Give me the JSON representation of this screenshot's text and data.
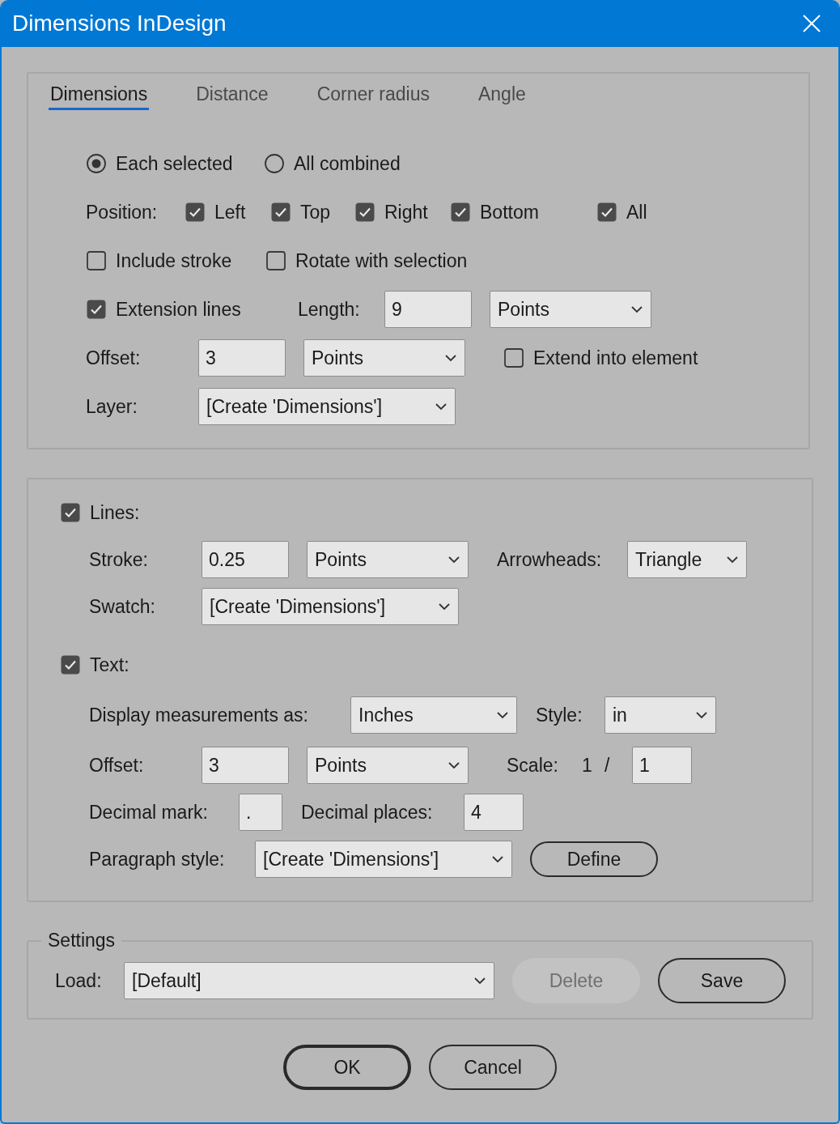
{
  "window": {
    "title": "Dimensions InDesign"
  },
  "tabs": [
    {
      "label": "Dimensions",
      "selected": true
    },
    {
      "label": "Distance",
      "selected": false
    },
    {
      "label": "Corner radius",
      "selected": false
    },
    {
      "label": "Angle",
      "selected": false
    }
  ],
  "mode": [
    {
      "label": "Each selected",
      "selected": true
    },
    {
      "label": "All combined",
      "selected": false
    }
  ],
  "position": {
    "label": "Position:",
    "options": [
      {
        "label": "Left",
        "checked": true
      },
      {
        "label": "Top",
        "checked": true
      },
      {
        "label": "Right",
        "checked": true
      },
      {
        "label": "Bottom",
        "checked": true
      },
      {
        "label": "All",
        "checked": true
      }
    ]
  },
  "include_stroke": {
    "label": "Include stroke",
    "checked": false
  },
  "rotate_with_selection": {
    "label": "Rotate with selection",
    "checked": false
  },
  "extension_lines": {
    "label": "Extension lines",
    "checked": true
  },
  "length": {
    "label": "Length:",
    "value": "9",
    "unit": "Points"
  },
  "offset": {
    "label": "Offset:",
    "value": "3",
    "unit": "Points"
  },
  "extend_into_element": {
    "label": "Extend into element",
    "checked": false
  },
  "layer": {
    "label": "Layer:",
    "value": "[Create 'Dimensions']"
  },
  "lines": {
    "label": "Lines:",
    "checked": true,
    "stroke": {
      "label": "Stroke:",
      "value": "0.25",
      "unit": "Points"
    },
    "arrowheads": {
      "label": "Arrowheads:",
      "value": "Triangle"
    },
    "swatch": {
      "label": "Swatch:",
      "value": "[Create 'Dimensions']"
    }
  },
  "text": {
    "label": "Text:",
    "checked": true,
    "display": {
      "label": "Display measurements as:",
      "value": "Inches"
    },
    "style": {
      "label": "Style:",
      "value": "in"
    },
    "offset": {
      "label": "Offset:",
      "value": "3",
      "unit": "Points"
    },
    "scale": {
      "label": "Scale:",
      "numerator": "1",
      "separator": "/",
      "value": "1"
    },
    "decimal_mark": {
      "label": "Decimal mark:",
      "value": "."
    },
    "decimal_places": {
      "label": "Decimal places:",
      "value": "4"
    },
    "paragraph_style": {
      "label": "Paragraph style:",
      "value": "[Create 'Dimensions']",
      "button": "Define"
    }
  },
  "settings": {
    "legend": "Settings",
    "load": {
      "label": "Load:",
      "value": "[Default]"
    },
    "buttons": [
      {
        "label": "Delete",
        "disabled": true
      },
      {
        "label": "Save",
        "disabled": false
      }
    ]
  },
  "footer_buttons": [
    {
      "label": "OK",
      "default": true
    },
    {
      "label": "Cancel",
      "default": false
    }
  ]
}
